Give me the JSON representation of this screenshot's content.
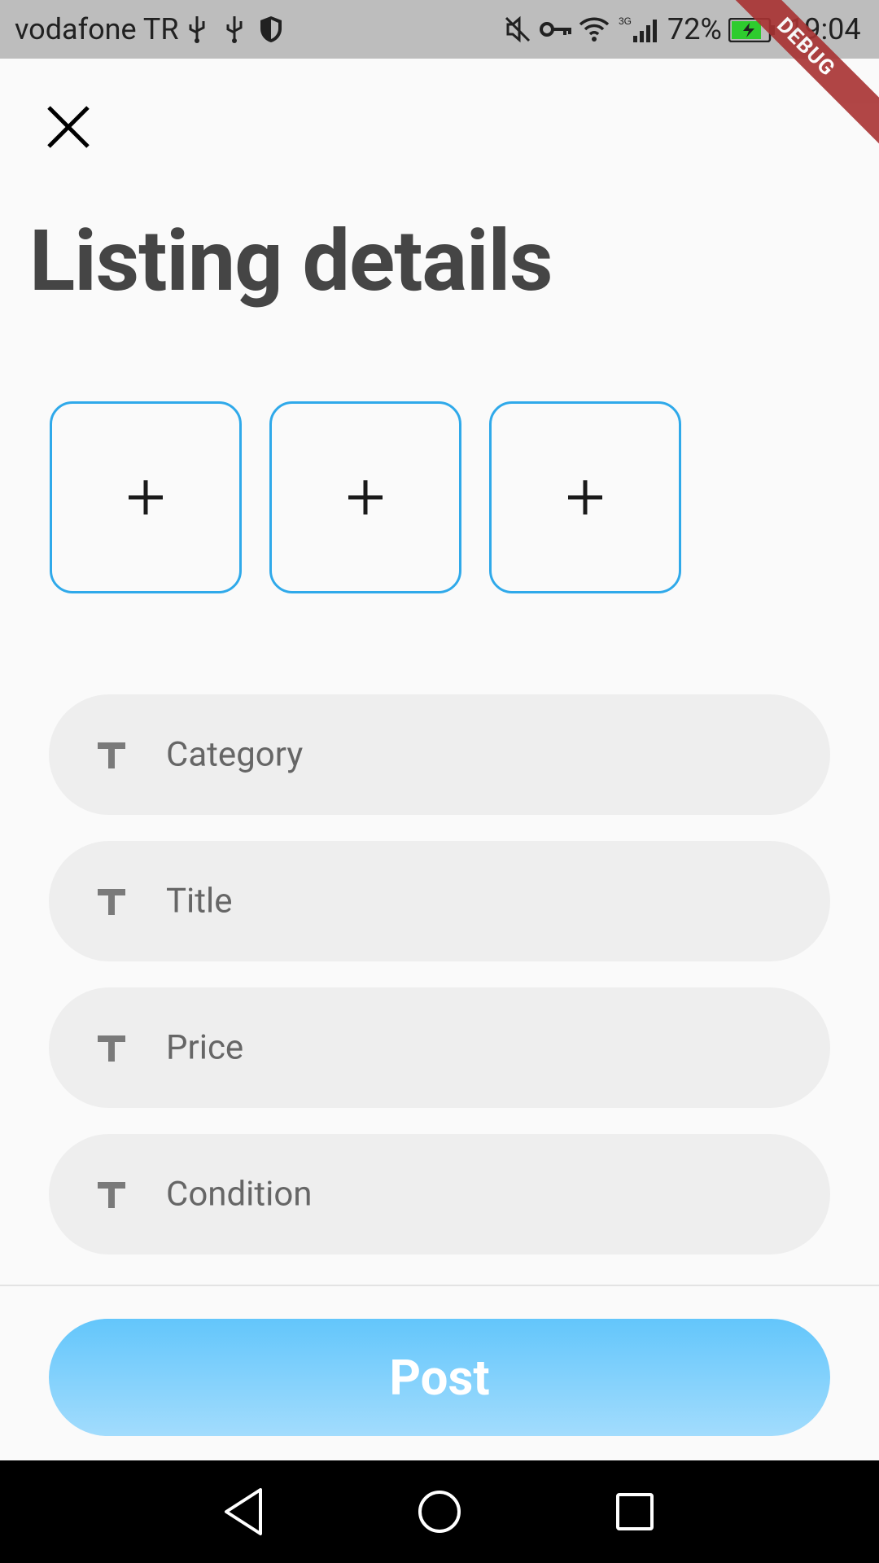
{
  "status_bar": {
    "carrier": "vodafone TR",
    "battery": "72%",
    "time": "19:04",
    "icons": [
      "usb-icon",
      "usb-icon",
      "shield-icon",
      "mute-icon",
      "vpn-key-icon",
      "wifi-icon",
      "signal-3g-icon",
      "battery-charging-icon"
    ]
  },
  "debug_banner": "DEBUG",
  "header": {
    "close_icon": "close-icon",
    "title": "Listing details"
  },
  "photos": {
    "slots": [
      {
        "icon": "plus-icon"
      },
      {
        "icon": "plus-icon"
      },
      {
        "icon": "plus-icon"
      }
    ]
  },
  "form": {
    "fields": [
      {
        "icon": "text-t-icon",
        "placeholder": "Category"
      },
      {
        "icon": "text-t-icon",
        "placeholder": "Title"
      },
      {
        "icon": "text-t-icon",
        "placeholder": "Price"
      },
      {
        "icon": "text-t-icon",
        "placeholder": "Condition"
      }
    ]
  },
  "actions": {
    "post_label": "Post"
  },
  "nav_bar": {
    "icons": [
      "back-icon",
      "home-icon",
      "recents-icon"
    ]
  },
  "colors": {
    "accent_border": "#2fa9ea",
    "button_gradient_top": "#63c6fb",
    "button_gradient_bottom": "#a2dcfd",
    "field_bg": "#eeeeee",
    "title": "#454545"
  }
}
